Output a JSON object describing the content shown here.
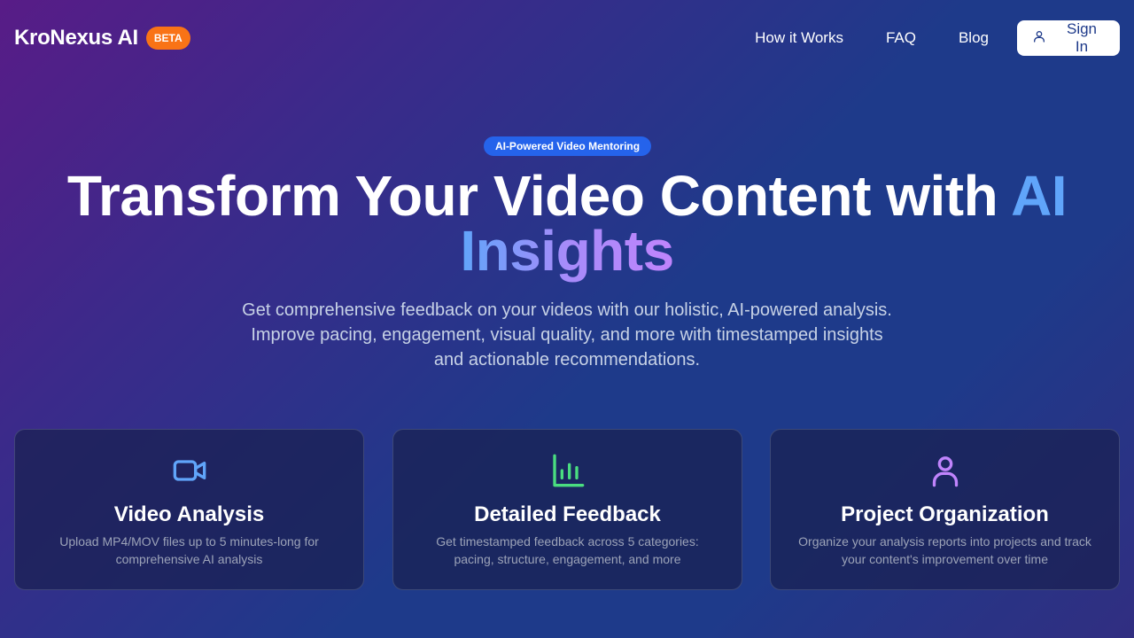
{
  "header": {
    "brand": "KroNexus AI",
    "badge": "BETA",
    "nav": [
      "How it Works",
      "FAQ",
      "Blog"
    ],
    "signin_label": "Sign In"
  },
  "hero": {
    "pill": "AI-Powered Video Mentoring",
    "headline_main": "Transform Your Video Content with",
    "headline_ai": "AI",
    "headline_insights": "Insights",
    "subtitle": "Get comprehensive feedback on your videos with our holistic, AI-powered analysis. Improve pacing, engagement, visual quality, and more with timestamped insights and actionable recommendations."
  },
  "features": [
    {
      "icon": "video-camera-icon",
      "title": "Video Analysis",
      "description": "Upload MP4/MOV files up to 5 minutes-long for comprehensive AI analysis"
    },
    {
      "icon": "bar-chart-icon",
      "title": "Detailed Feedback",
      "description": "Get timestamped feedback across 5 categories: pacing, structure, engagement, and more"
    },
    {
      "icon": "user-icon",
      "title": "Project Organization",
      "description": "Organize your analysis reports into projects and track your content's improvement over time"
    }
  ],
  "colors": {
    "badge": "#f97316",
    "pill": "#2563eb",
    "ai_accent": "#60a5fa",
    "insights_gradient_end": "#c084fc",
    "video_icon": "#60a5fa",
    "chart_icon": "#4ade80",
    "user_icon": "#c084fc"
  }
}
